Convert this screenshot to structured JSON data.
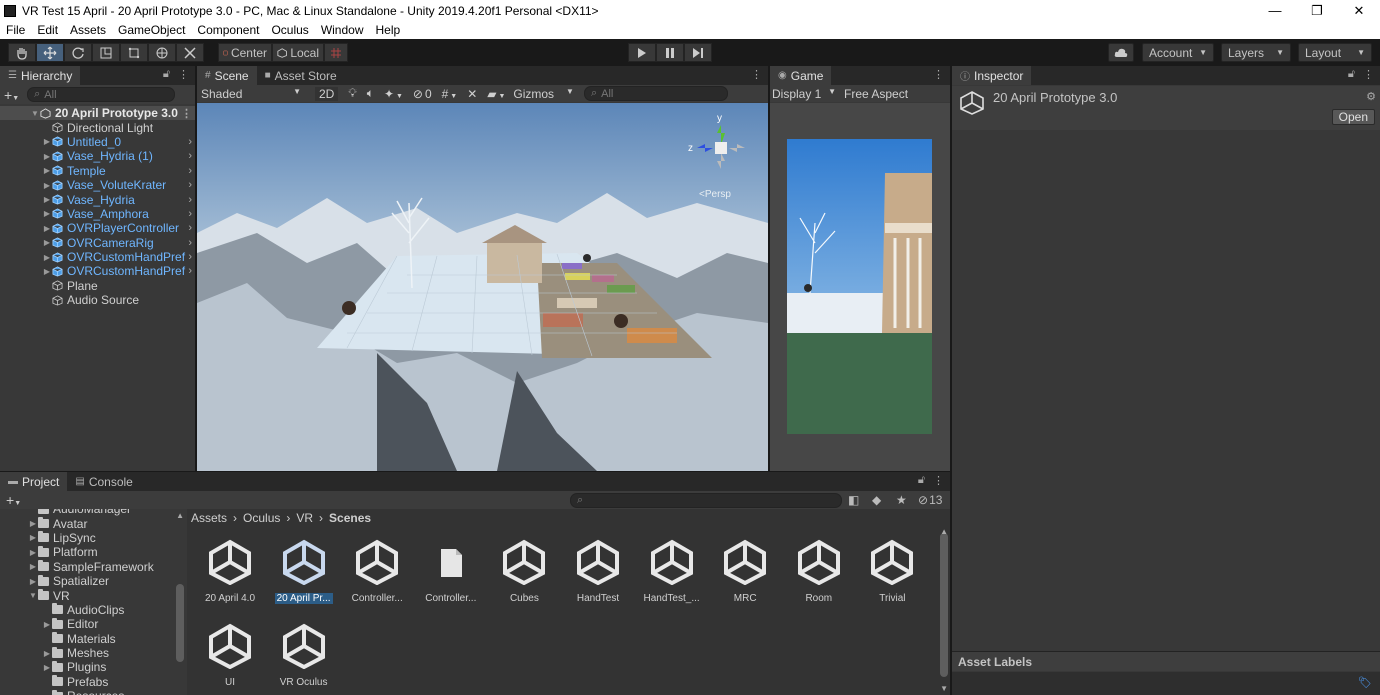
{
  "window": {
    "title": "VR Test 15 April - 20 April Prototype 3.0 - PC, Mac & Linux Standalone - Unity 2019.4.20f1 Personal <DX11>",
    "minimize": "—",
    "restore": "❐",
    "close": "✕"
  },
  "menu": [
    "File",
    "Edit",
    "Assets",
    "GameObject",
    "Component",
    "Oculus",
    "Window",
    "Help"
  ],
  "toolbar": {
    "pivot": "Center",
    "space": "Local",
    "account": "Account",
    "layers": "Layers",
    "layout": "Layout"
  },
  "hierarchy": {
    "tab": "Hierarchy",
    "search_placeholder": "All",
    "scene_name": "20 April Prototype 3.0",
    "items": [
      {
        "label": "Directional Light",
        "prefab": false,
        "expandable": false
      },
      {
        "label": "Untitled_0",
        "prefab": true,
        "expandable": true
      },
      {
        "label": "Vase_Hydria (1)",
        "prefab": true,
        "expandable": true
      },
      {
        "label": "Temple",
        "prefab": true,
        "expandable": true
      },
      {
        "label": "Vase_VoluteKrater",
        "prefab": true,
        "expandable": true
      },
      {
        "label": "Vase_Hydria",
        "prefab": true,
        "expandable": true
      },
      {
        "label": "Vase_Amphora",
        "prefab": true,
        "expandable": true
      },
      {
        "label": "OVRPlayerController",
        "prefab": true,
        "expandable": true
      },
      {
        "label": "OVRCameraRig",
        "prefab": true,
        "expandable": true
      },
      {
        "label": "OVRCustomHandPref",
        "prefab": true,
        "expandable": true
      },
      {
        "label": "OVRCustomHandPref",
        "prefab": true,
        "expandable": true
      },
      {
        "label": "Plane",
        "prefab": false,
        "expandable": false
      },
      {
        "label": "Audio Source",
        "prefab": false,
        "expandable": false
      }
    ]
  },
  "scene": {
    "tab_scene": "Scene",
    "tab_asset_store": "Asset Store",
    "shading": "Shaded",
    "mode_2d": "2D",
    "hidden_count": "0",
    "gizmos": "Gizmos",
    "search_placeholder": "All",
    "gizmo_y": "y",
    "gizmo_z": "z",
    "persp": "<Persp"
  },
  "game": {
    "tab": "Game",
    "display": "Display 1",
    "aspect": "Free Aspect"
  },
  "inspector": {
    "tab": "Inspector",
    "object_name": "20 April Prototype 3.0",
    "open_button": "Open",
    "asset_labels": "Asset Labels"
  },
  "project": {
    "tab_project": "Project",
    "tab_console": "Console",
    "hidden_count": "13",
    "breadcrumb": [
      "Assets",
      "Oculus",
      "VR",
      "Scenes"
    ],
    "tree": [
      {
        "label": "AudioManager",
        "indent": 2,
        "expandable": false,
        "expanded": false
      },
      {
        "label": "Avatar",
        "indent": 2,
        "expandable": true,
        "expanded": false
      },
      {
        "label": "LipSync",
        "indent": 2,
        "expandable": true,
        "expanded": false
      },
      {
        "label": "Platform",
        "indent": 2,
        "expandable": true,
        "expanded": false
      },
      {
        "label": "SampleFramework",
        "indent": 2,
        "expandable": true,
        "expanded": false
      },
      {
        "label": "Spatializer",
        "indent": 2,
        "expandable": true,
        "expanded": false
      },
      {
        "label": "VR",
        "indent": 2,
        "expandable": true,
        "expanded": true
      },
      {
        "label": "AudioClips",
        "indent": 3,
        "expandable": false,
        "expanded": false
      },
      {
        "label": "Editor",
        "indent": 3,
        "expandable": true,
        "expanded": false
      },
      {
        "label": "Materials",
        "indent": 3,
        "expandable": false,
        "expanded": false
      },
      {
        "label": "Meshes",
        "indent": 3,
        "expandable": true,
        "expanded": false
      },
      {
        "label": "Plugins",
        "indent": 3,
        "expandable": true,
        "expanded": false
      },
      {
        "label": "Prefabs",
        "indent": 3,
        "expandable": false,
        "expanded": false
      },
      {
        "label": "Resources",
        "indent": 3,
        "expandable": false,
        "expanded": false
      }
    ],
    "assets": [
      {
        "label": "20 April 4.0",
        "kind": "scene",
        "selected": false
      },
      {
        "label": "20 April Pr...",
        "kind": "scene",
        "selected": true
      },
      {
        "label": "Controller...",
        "kind": "scene",
        "selected": false
      },
      {
        "label": "Controller...",
        "kind": "file",
        "selected": false
      },
      {
        "label": "Cubes",
        "kind": "scene",
        "selected": false
      },
      {
        "label": "HandTest",
        "kind": "scene",
        "selected": false
      },
      {
        "label": "HandTest_...",
        "kind": "scene",
        "selected": false
      },
      {
        "label": "MRC",
        "kind": "scene",
        "selected": false
      },
      {
        "label": "Room",
        "kind": "scene",
        "selected": false
      },
      {
        "label": "Trivial",
        "kind": "scene",
        "selected": false
      },
      {
        "label": "UI",
        "kind": "scene",
        "selected": false
      },
      {
        "label": "VR Oculus",
        "kind": "scene",
        "selected": false
      }
    ]
  },
  "colors": {
    "accent": "#46607c",
    "selection": "#2c5d87",
    "prefab_text": "#6fb6ff"
  }
}
